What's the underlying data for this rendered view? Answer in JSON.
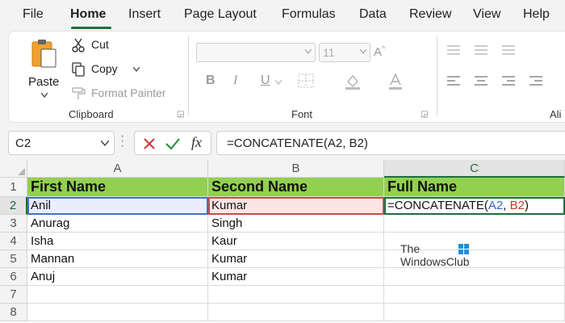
{
  "menu": {
    "tabs": [
      "File",
      "Home",
      "Insert",
      "Page Layout",
      "Formulas",
      "Data",
      "Review",
      "View",
      "Help"
    ],
    "active_tab": "Home"
  },
  "ribbon": {
    "clipboard": {
      "paste_label": "Paste",
      "cut_label": "Cut",
      "copy_label": "Copy",
      "format_painter_label": "Format Painter",
      "group_label": "Clipboard"
    },
    "font": {
      "font_name": "",
      "font_size": "11",
      "group_label": "Font"
    },
    "alignment": {
      "group_label_partial": "Ali"
    }
  },
  "formula_bar": {
    "name_box": "C2",
    "formula": "=CONCATENATE(A2, B2)"
  },
  "grid": {
    "columns": [
      "A",
      "B",
      "C"
    ],
    "rows": [
      "1",
      "2",
      "3",
      "4",
      "5",
      "6",
      "7",
      "8"
    ],
    "headers": [
      "First Name",
      "Second Name",
      "Full Name"
    ],
    "data": [
      [
        "Anil",
        "Kumar"
      ],
      [
        "Anurag",
        "Singh"
      ],
      [
        "Isha",
        "Kaur"
      ],
      [
        "Mannan",
        "Kumar"
      ],
      [
        "Anuj",
        "Kumar"
      ]
    ],
    "active_cell_formula": {
      "prefix": "=CONCATENATE(",
      "ref_a": "A2",
      "sep": ", ",
      "ref_b": "B2",
      "suffix": ")"
    }
  },
  "watermark": {
    "line1": "The",
    "line2": "WindowsClub"
  },
  "colors": {
    "accent": "#1e6e3c",
    "header_fill": "#92d050",
    "ref_a": "#4472c4",
    "ref_b": "#c0504d"
  }
}
